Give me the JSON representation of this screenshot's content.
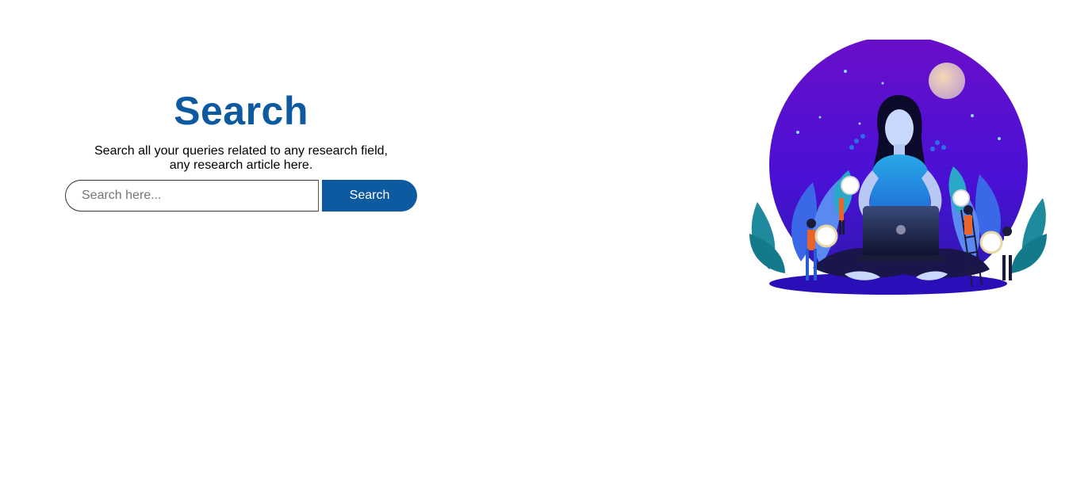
{
  "hero": {
    "title": "Search",
    "subtitle": "Search all your queries related to any research field, any research article here."
  },
  "search": {
    "placeholder": "Search here...",
    "value": "",
    "button_label": "Search"
  },
  "colors": {
    "brand": "#0d5aa0",
    "illustration_purple": "#5a0fd0",
    "illustration_blue": "#2a5bd7",
    "illustration_teal": "#1f8a9c"
  },
  "icons": {
    "illustration": "woman-with-laptop-research-illustration"
  }
}
